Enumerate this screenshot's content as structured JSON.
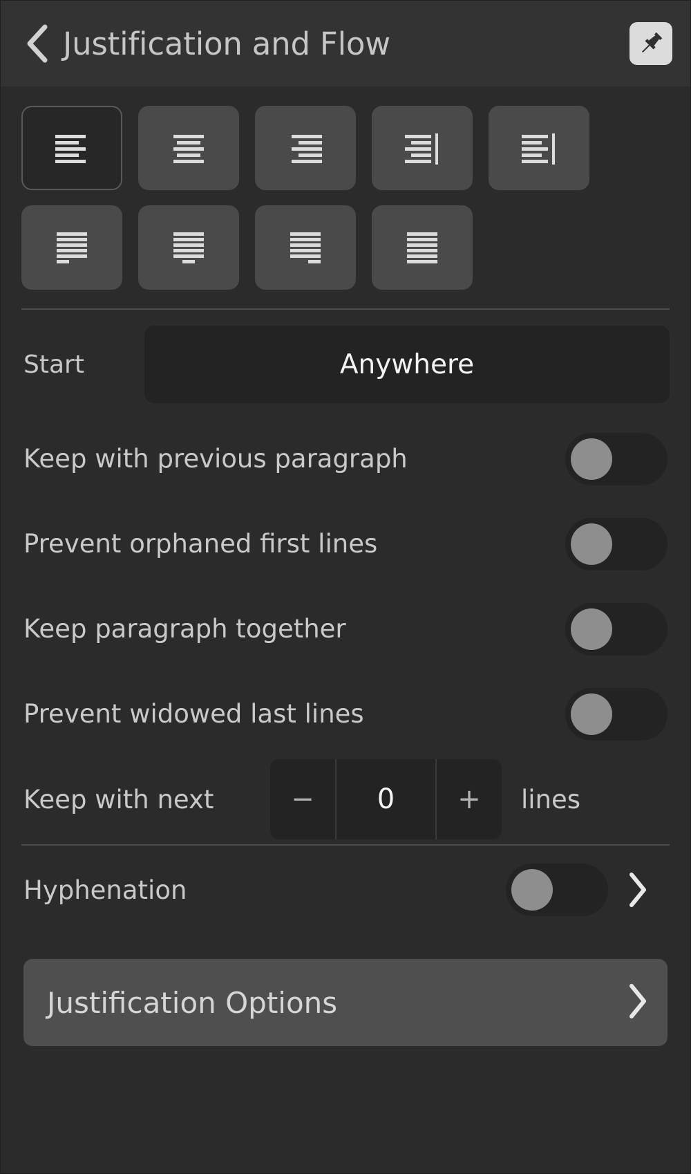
{
  "header": {
    "title": "Justification and Flow",
    "back_icon": "chevron-left-icon",
    "pin_icon": "pushpin-icon"
  },
  "alignment": {
    "row1": [
      {
        "name": "align-left",
        "icon": "align-left-icon",
        "selected": true
      },
      {
        "name": "align-center",
        "icon": "align-center-icon",
        "selected": false
      },
      {
        "name": "align-right",
        "icon": "align-right-icon",
        "selected": false
      },
      {
        "name": "align-right-toward-spine",
        "icon": "align-right-bar-icon",
        "selected": false
      },
      {
        "name": "align-left-away-from-spine",
        "icon": "align-left-bar-icon",
        "selected": false
      }
    ],
    "row2": [
      {
        "name": "justify-last-left",
        "icon": "justify-last-left-icon",
        "selected": false
      },
      {
        "name": "justify-last-center",
        "icon": "justify-last-center-icon",
        "selected": false
      },
      {
        "name": "justify-last-right",
        "icon": "justify-last-right-icon",
        "selected": false
      },
      {
        "name": "justify-all",
        "icon": "justify-all-icon",
        "selected": false
      }
    ]
  },
  "start": {
    "label": "Start",
    "value": "Anywhere"
  },
  "toggles": [
    {
      "label": "Keep with previous paragraph",
      "on": false
    },
    {
      "label": "Prevent orphaned first lines",
      "on": false
    },
    {
      "label": "Keep paragraph together",
      "on": false
    },
    {
      "label": "Prevent widowed last lines",
      "on": false
    }
  ],
  "stepper": {
    "label": "Keep with next",
    "minus": "−",
    "value": "0",
    "plus": "+",
    "unit": "lines"
  },
  "hyphenation": {
    "label": "Hyphenation",
    "on": false,
    "chevron_icon": "chevron-right-icon"
  },
  "justification_options": {
    "label": "Justification Options",
    "chevron_icon": "chevron-right-icon"
  },
  "colors": {
    "panel_bg": "#2b2b2b",
    "header_bg": "#333333",
    "button_bg": "#4a4a4a",
    "selected_bg": "#272727",
    "field_bg": "#232323",
    "text": "#c9c9c9",
    "text_bright": "#f2f2f2",
    "divider": "#4d4d4d",
    "knob": "#8e8e8e",
    "pin_bg": "#dcdcdc"
  }
}
